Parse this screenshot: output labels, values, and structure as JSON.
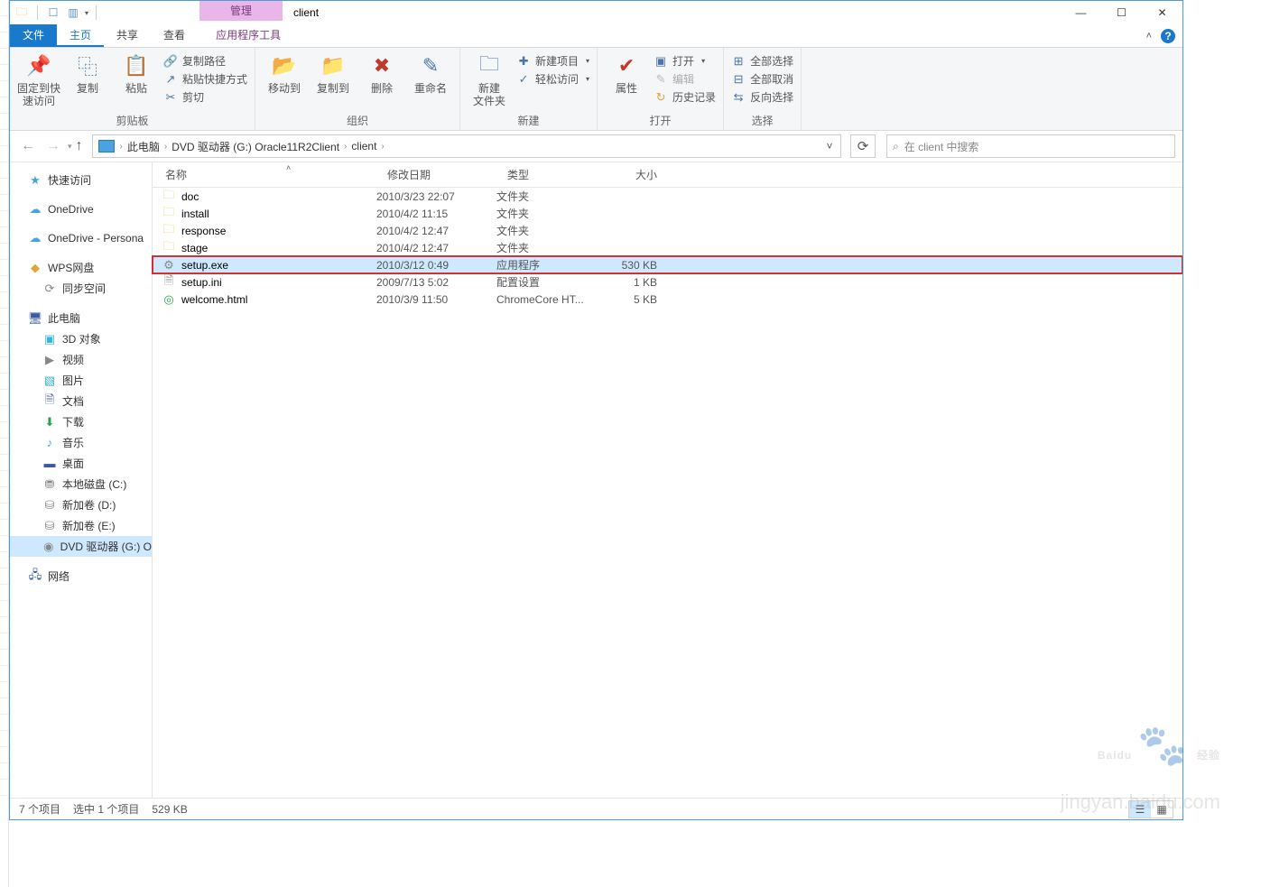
{
  "titlebar": {
    "context_tab": "管理",
    "title": "client"
  },
  "tabs": {
    "file": "文件",
    "home": "主页",
    "share": "共享",
    "view": "查看",
    "apptools": "应用程序工具"
  },
  "ribbon": {
    "clipboard": {
      "pin": "固定到快\n速访问",
      "copy": "复制",
      "paste": "粘贴",
      "copy_path": "复制路径",
      "paste_shortcut": "粘贴快捷方式",
      "cut": "剪切",
      "label": "剪贴板"
    },
    "organize": {
      "move_to": "移动到",
      "copy_to": "复制到",
      "delete": "删除",
      "rename": "重命名",
      "label": "组织"
    },
    "new_group": {
      "new_folder": "新建\n文件夹",
      "new_item": "新建项目",
      "easy_access": "轻松访问",
      "label": "新建"
    },
    "open_group": {
      "properties": "属性",
      "open": "打开",
      "edit": "编辑",
      "history": "历史记录",
      "label": "打开"
    },
    "select_group": {
      "select_all": "全部选择",
      "select_none": "全部取消",
      "invert": "反向选择",
      "label": "选择"
    }
  },
  "addr": {
    "pc": "此电脑",
    "drive": "DVD 驱动器 (G:) Oracle11R2Client",
    "folder": "client",
    "search_placeholder": "在 client 中搜索"
  },
  "columns": {
    "name": "名称",
    "date": "修改日期",
    "type": "类型",
    "size": "大小"
  },
  "files": [
    {
      "icon": "folder",
      "name": "doc",
      "date": "2010/3/23 22:07",
      "type": "文件夹",
      "size": ""
    },
    {
      "icon": "folder",
      "name": "install",
      "date": "2010/4/2 11:15",
      "type": "文件夹",
      "size": ""
    },
    {
      "icon": "folder",
      "name": "response",
      "date": "2010/4/2 12:47",
      "type": "文件夹",
      "size": ""
    },
    {
      "icon": "folder",
      "name": "stage",
      "date": "2010/4/2 12:47",
      "type": "文件夹",
      "size": ""
    },
    {
      "icon": "exe",
      "name": "setup.exe",
      "date": "2010/3/12 0:49",
      "type": "应用程序",
      "size": "530 KB",
      "highlight": true
    },
    {
      "icon": "ini",
      "name": "setup.ini",
      "date": "2009/7/13 5:02",
      "type": "配置设置",
      "size": "1 KB"
    },
    {
      "icon": "html",
      "name": "welcome.html",
      "date": "2010/3/9 11:50",
      "type": "ChromeCore HT...",
      "size": "5 KB"
    }
  ],
  "sidebar": {
    "quick_access": "快速访问",
    "onedrive": "OneDrive",
    "onedrive_personal": "OneDrive - Persona",
    "wps": "WPS网盘",
    "sync": "同步空间",
    "this_pc": "此电脑",
    "objects3d": "3D 对象",
    "videos": "视频",
    "pictures": "图片",
    "documents": "文档",
    "downloads": "下载",
    "music": "音乐",
    "desktop": "桌面",
    "disk_c": "本地磁盘 (C:)",
    "disk_d": "新加卷 (D:)",
    "disk_e": "新加卷 (E:)",
    "dvd_g": "DVD 驱动器 (G:) O",
    "network": "网络"
  },
  "status": {
    "count": "7 个项目",
    "selected": "选中 1 个项目",
    "size": "529 KB"
  },
  "watermark": {
    "brand": "Baidu",
    "cn": "经验",
    "sub": "jingyan.baidu.com"
  }
}
